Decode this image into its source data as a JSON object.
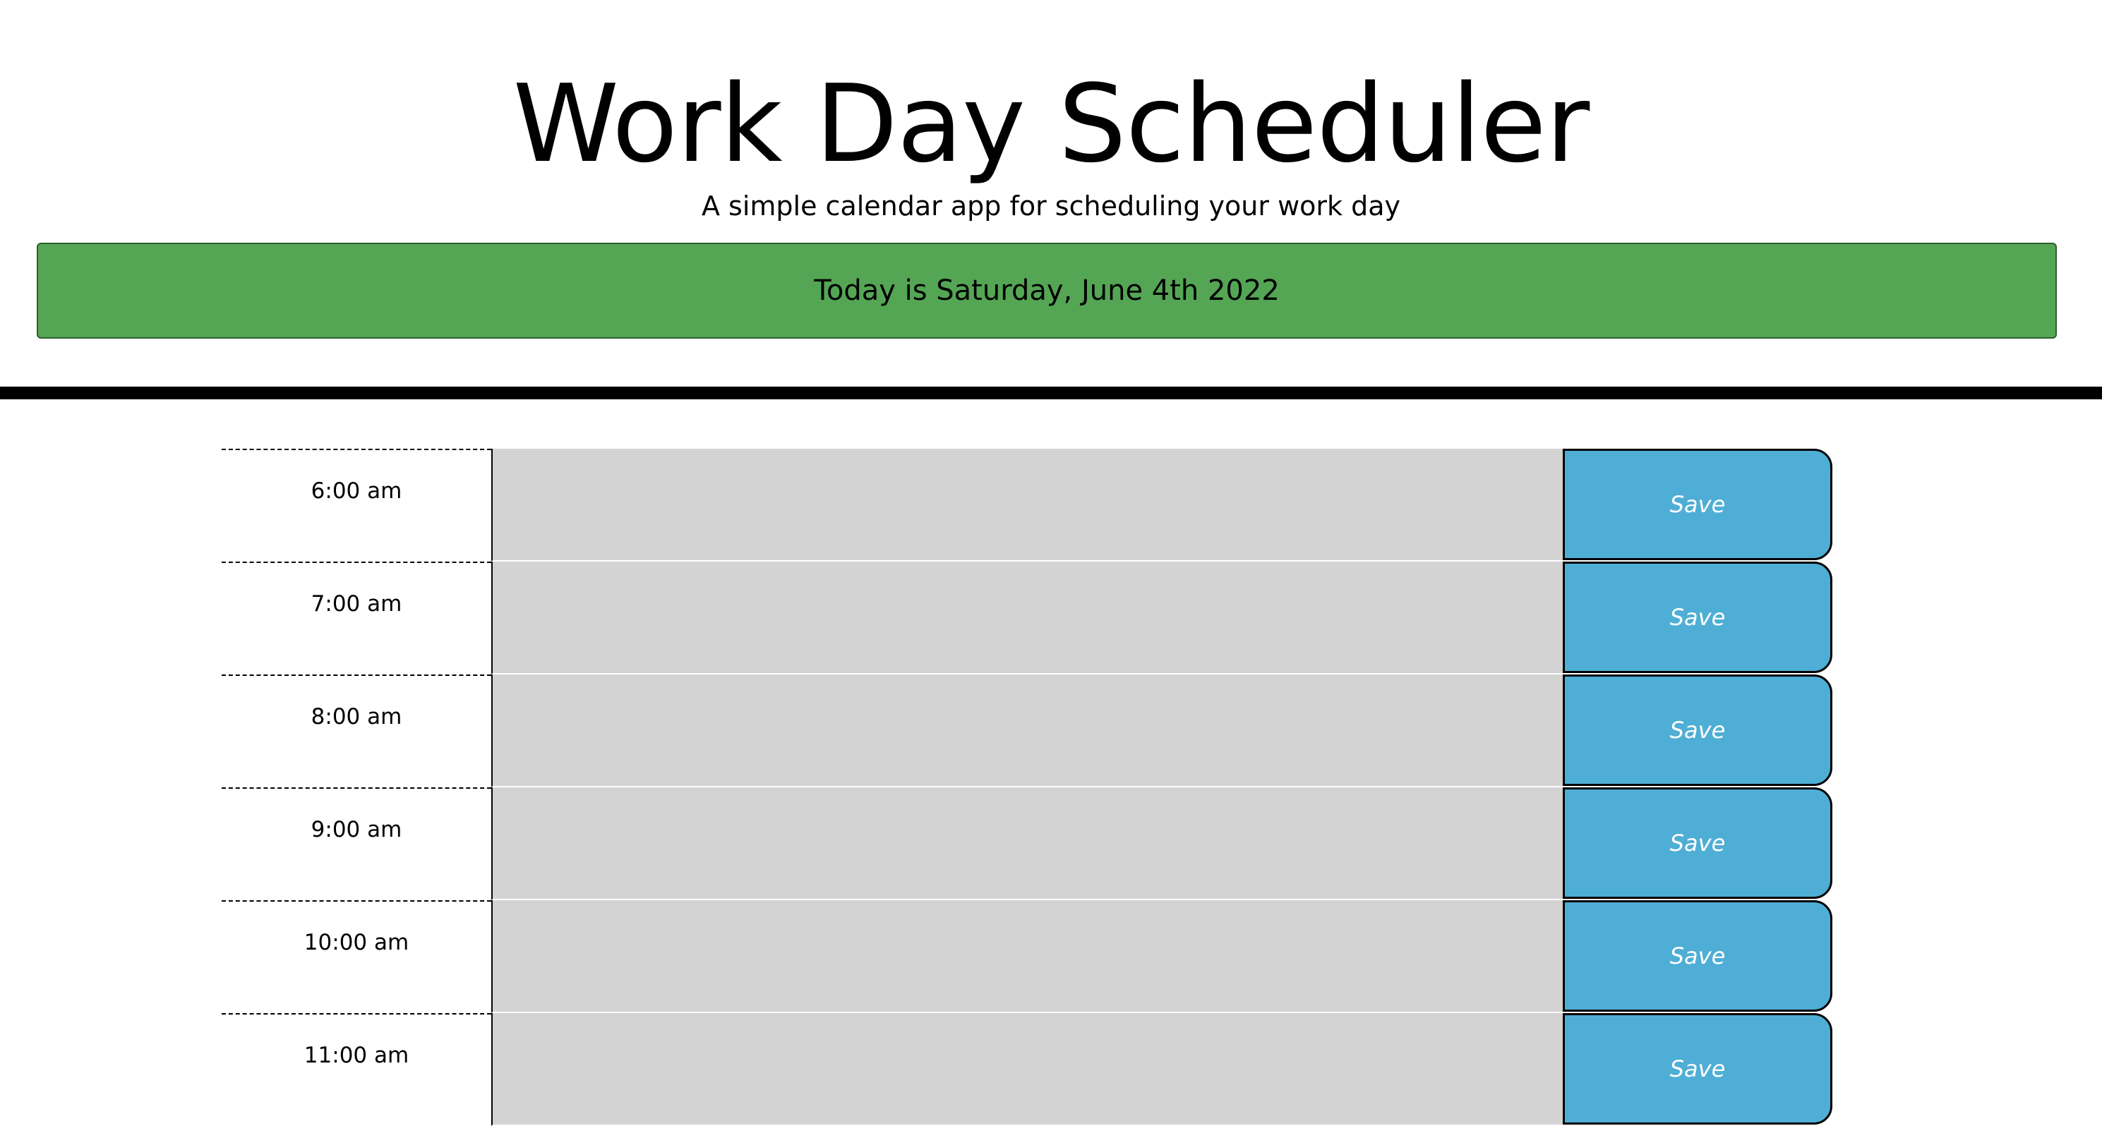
{
  "header": {
    "title": "Work Day Scheduler",
    "subtitle": "A simple calendar app for scheduling your work day",
    "current_day": "Today is Saturday, June 4th 2022"
  },
  "colors": {
    "banner": "#54a654",
    "past_block": "#d3d3d3",
    "save_button": "#4faed5"
  },
  "schedule": {
    "rows": [
      {
        "hour": "6:00 am",
        "event": "",
        "save_label": "Save"
      },
      {
        "hour": "7:00 am",
        "event": "",
        "save_label": "Save"
      },
      {
        "hour": "8:00 am",
        "event": "",
        "save_label": "Save"
      },
      {
        "hour": "9:00 am",
        "event": "",
        "save_label": "Save"
      },
      {
        "hour": "10:00 am",
        "event": "",
        "save_label": "Save"
      },
      {
        "hour": "11:00 am",
        "event": "",
        "save_label": "Save"
      }
    ]
  }
}
